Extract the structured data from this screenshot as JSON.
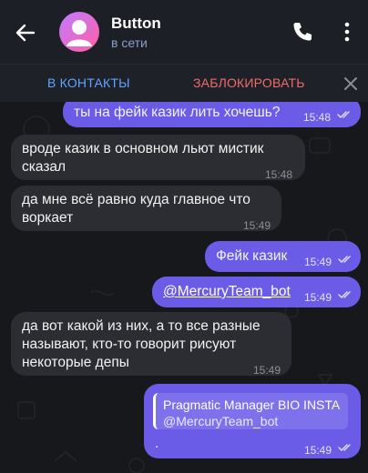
{
  "header": {
    "title": "Button",
    "status": "в сети",
    "icons": {
      "back": "arrow-left-icon",
      "call": "phone-icon",
      "more": "more-vertical-icon"
    }
  },
  "actionbar": {
    "add_contact": "В КОНТАКТЫ",
    "block": "ЗАБЛОКИРОВАТЬ",
    "close_icon": "close-icon"
  },
  "colors": {
    "accent": "#6b5ce7",
    "incoming": "#2b2d33",
    "link": "#5fa5ff",
    "danger": "#f06b6b"
  },
  "messages": [
    {
      "direction": "out",
      "lines": [
        "ты на фейк казик лить хочешь?"
      ],
      "time": "15:48",
      "read": true
    },
    {
      "direction": "in",
      "lines": [
        "вроде казик в основном льют мистик",
        "сказал"
      ],
      "time": "15:48"
    },
    {
      "direction": "in",
      "lines": [
        "да мне всё равно куда главное что",
        "воркает"
      ],
      "time": "15:49"
    },
    {
      "direction": "out",
      "lines": [
        "Фейк казик"
      ],
      "time": "15:49",
      "read": true
    },
    {
      "direction": "out",
      "lines": [
        "@MercuryTeam_bot"
      ],
      "time": "15:49",
      "read": true
    },
    {
      "direction": "in",
      "lines": [
        "да вот какой из них, а то все разные",
        "называют, кто-то говорит рисуют",
        "некоторые депы"
      ],
      "time": "15:49"
    },
    {
      "direction": "out",
      "quote_title": "Pragmatic Manager BIO INSTA",
      "quote_sub": "@MercuryTeam_bot",
      "lines": [
        "."
      ],
      "time": "15:49",
      "read": true
    }
  ]
}
